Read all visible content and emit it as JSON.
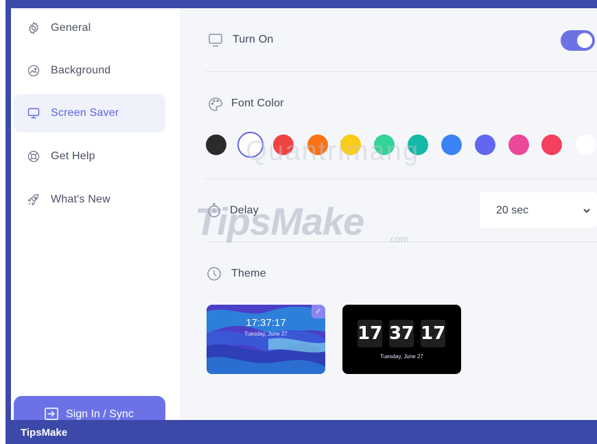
{
  "sidebar": {
    "items": [
      {
        "label": "General",
        "icon": "gear-icon"
      },
      {
        "label": "Background",
        "icon": "image-icon"
      },
      {
        "label": "Screen Saver",
        "icon": "monitor-icon"
      },
      {
        "label": "Get Help",
        "icon": "lifebuoy-icon"
      },
      {
        "label": "What's New",
        "icon": "rocket-icon"
      }
    ],
    "active": "Screen Saver",
    "signin_label": "Sign In / Sync"
  },
  "settings": {
    "turn_on_label": "Turn On",
    "turn_on_value": true,
    "font_color_label": "Font Color",
    "colors": [
      "#2b2b2b",
      "#ffffff",
      "#ef4444",
      "#f97316",
      "#facc15",
      "#34d399",
      "#14b8a6",
      "#3b82f6",
      "#6366f1",
      "#ec4899",
      "#f43f5e",
      "#ffffff"
    ],
    "selected_color_index": 1,
    "delay_label": "Delay",
    "delay_value": "20 sec",
    "theme_label": "Theme"
  },
  "themes": [
    {
      "time": "17:37:17",
      "date": "Tuesday, June 27",
      "selected": true
    },
    {
      "hours": "17",
      "minutes": "37",
      "seconds": "17",
      "date": "Tuesday, June 27",
      "selected": false
    }
  ],
  "watermarks": {
    "tipsmake": "TipsMake",
    "com": ".com",
    "quantrimang": "Quantrimang"
  },
  "footer": {
    "brand": "TipsMake"
  },
  "colors": {
    "accent": "#6c72e6",
    "frame": "#3d49a8"
  }
}
